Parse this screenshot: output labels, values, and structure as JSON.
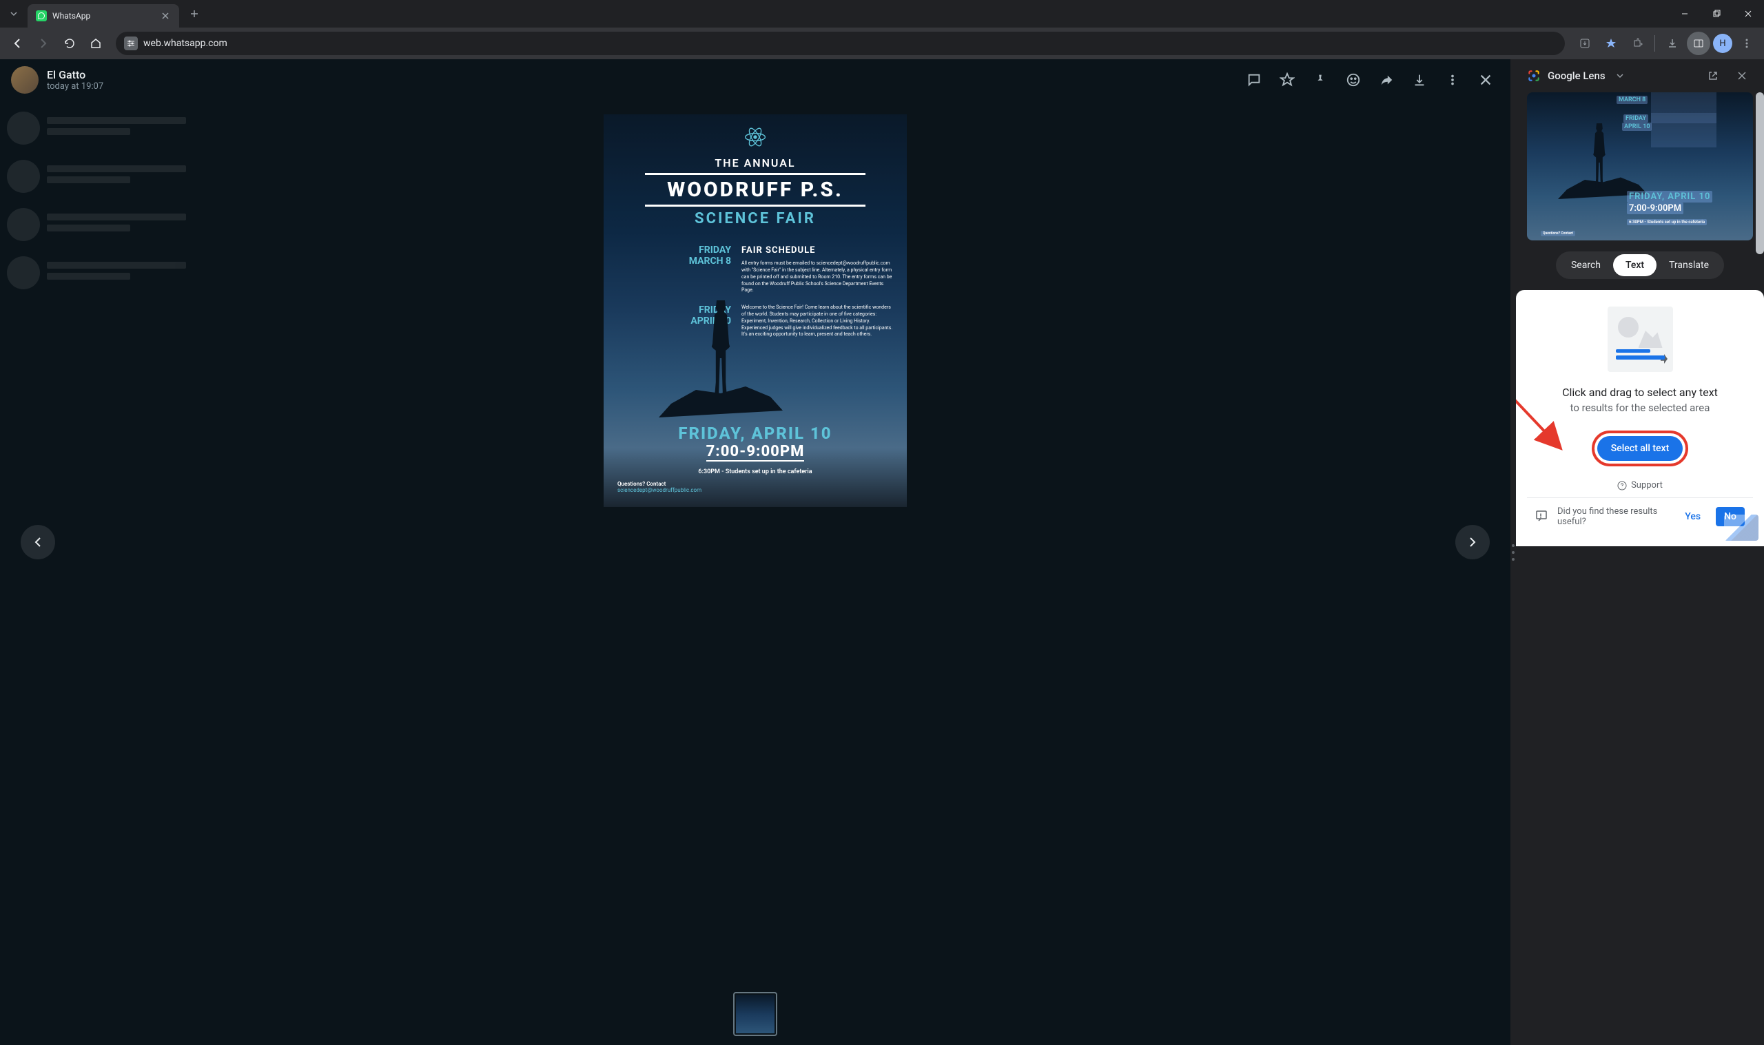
{
  "browser": {
    "tab_title": "WhatsApp",
    "url": "web.whatsapp.com"
  },
  "wa": {
    "sender": "El Gatto",
    "timestamp": "today at 19:07"
  },
  "poster": {
    "annual": "THE ANNUAL",
    "title": "WOODRUFF P.S.",
    "subtitle": "SCIENCE FAIR",
    "schedule_h": "FAIR SCHEDULE",
    "date1_a": "FRIDAY",
    "date1_b": "MARCH 8",
    "text1": "All entry forms must be emailed to sciencedept@woodruffpublic.com with \"Science Fair\" in the subject line. Alternately, a physical entry form can be printed off and submitted to Room 210. The entry forms can be found on the Woodruff Public School's Science Department Events Page.",
    "date2_a": "FRIDAY",
    "date2_b": "APRIL 10",
    "text2": "Welcome to the Science Fair! Come learn about the scientific wonders of the world. Students may participate in one of five categories: Experiment, Invention, Research, Collection or Living History. Experienced judges will give individualized feedback to all participants. It's an exciting opportunity to learn, present and teach others.",
    "event_date": "FRIDAY, APRIL 10",
    "event_time": "7:00-9:00PM",
    "note": "6:30PM - Students set up in the cafeteria",
    "questions": "Questions? Contact",
    "email": "sciencedept@woodruffpublic.com"
  },
  "lens": {
    "title": "Google Lens",
    "tabs": {
      "search": "Search",
      "text": "Text",
      "translate": "Translate"
    },
    "preview": {
      "hl1": "MARCH 8",
      "hl2": "FRIDAY",
      "hl3": "APRIL 10",
      "hl_big_date": "FRIDAY, APRIL 10",
      "hl_big_time": "7:00-9:00PM",
      "hl_note": "6:30PM - Students set up in the cafeteria",
      "hl_q": "Questions? Contact"
    },
    "msg1": "Click and drag to select any text",
    "msg2": "to results for the selected area",
    "select_all": "Select all text",
    "support": "Support",
    "feedback_q": "Did you find these results useful?",
    "yes": "Yes",
    "no": "No"
  }
}
